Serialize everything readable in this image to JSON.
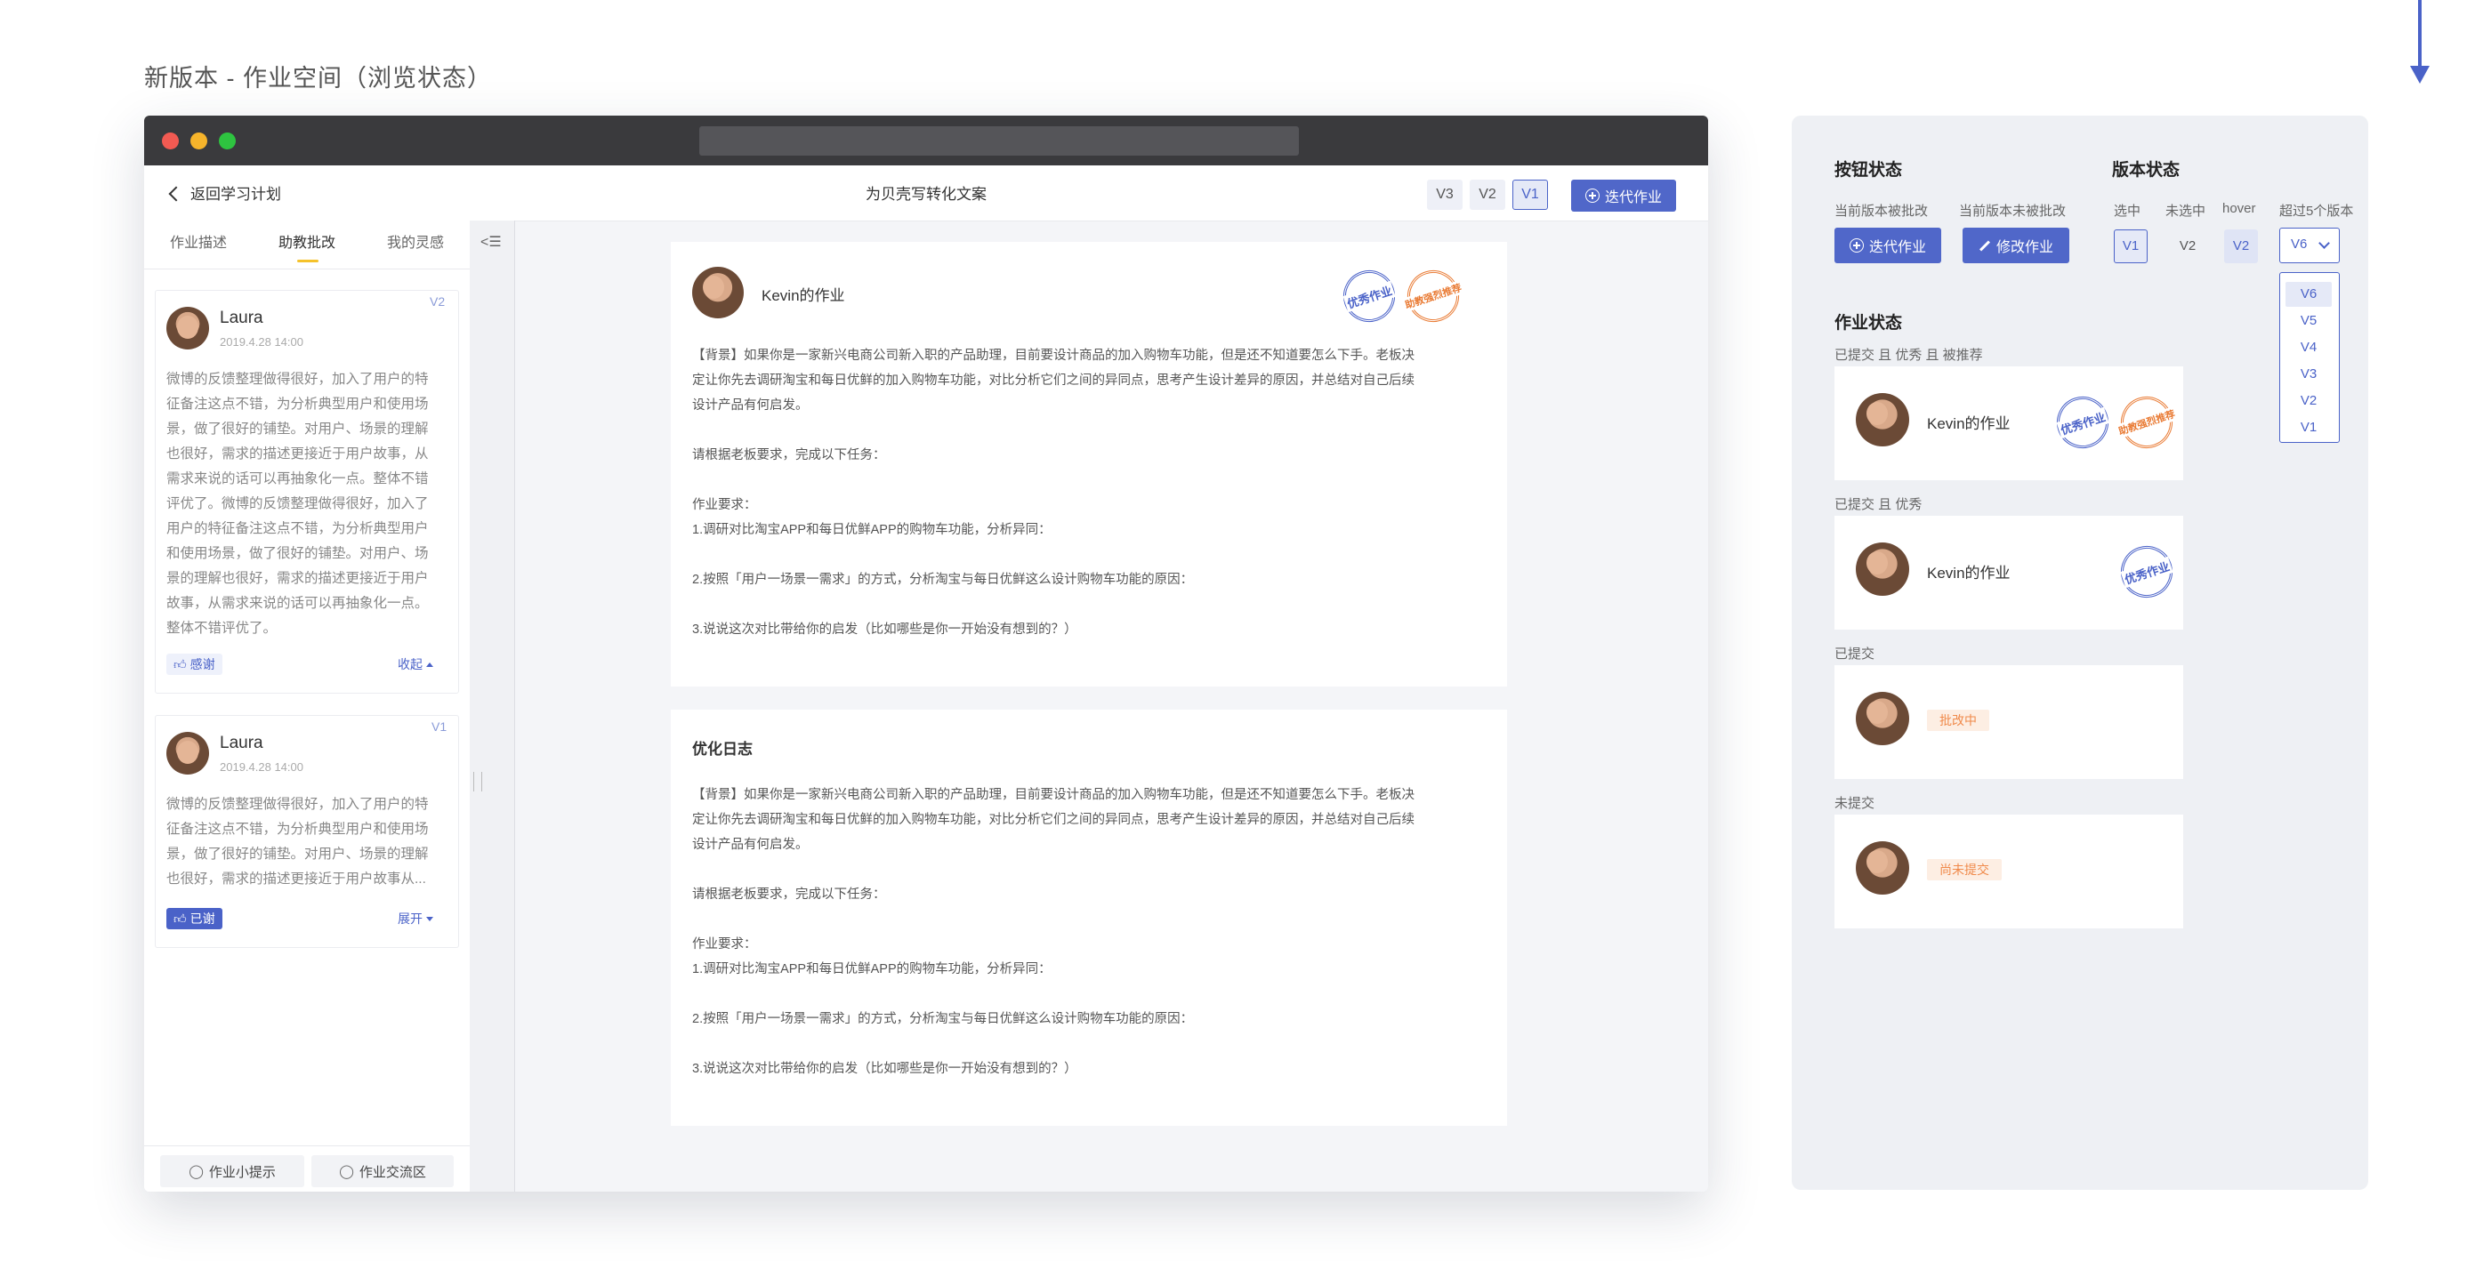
{
  "page_title": "新版本 - 作业空间（浏览状态）",
  "topbar": {
    "back_label": "返回学习计划",
    "title": "为贝壳写转化文案",
    "versions": [
      "V3",
      "V2",
      "V1"
    ],
    "active_version": "V1",
    "iterate_label": "迭代作业"
  },
  "left_tabs": [
    "作业描述",
    "助教批改",
    "我的灵感"
  ],
  "active_tab": "助教批改",
  "comments": [
    {
      "name": "Laura",
      "date": "2019.4.28  14:00",
      "version": "V2",
      "lines": [
        "微博的反馈整理做得很好，加入了用户的特",
        "征备注这点不错，为分析典型用户和使用场",
        "景，做了很好的铺垫。对用户、场景的理解",
        "也很好，需求的描述更接近于用户故事，从",
        "需求来说的话可以再抽象化一点。整体不错",
        "评优了。微博的反馈整理做得很好，加入了",
        "用户的特征备注这点不错，为分析典型用户",
        "和使用场景，做了很好的铺垫。对用户、场",
        "景的理解也很好，需求的描述更接近于用户",
        "故事，从需求来说的话可以再抽象化一点。",
        "整体不错评优了。"
      ],
      "thanks_label": "感谢",
      "toggle_label": "收起"
    },
    {
      "name": "Laura",
      "date": "2019.4.28  14:00",
      "version": "V1",
      "lines": [
        "微博的反馈整理做得很好，加入了用户的特",
        "征备注这点不错，为分析典型用户和使用场",
        "景，做了很好的铺垫。对用户、场景的理解",
        "也很好，需求的描述更接近于用户故事从..."
      ],
      "thanks_label": "已谢",
      "toggle_label": "展开"
    }
  ],
  "bottom_buttons": [
    "作业小提示",
    "作业交流区"
  ],
  "homework": {
    "author": "Kevin的作业",
    "stamps": [
      "优秀作业",
      "助教强烈推荐"
    ],
    "paragraphs": [
      "【背景】如果你是一家新兴电商公司新入职的产品助理，目前要设计商品的加入购物车功能，但是还不知道要怎么下手。老板决",
      "定让你先去调研淘宝和每日优鲜的加入购物车功能，对比分析它们之间的异同点，思考产生设计差异的原因，并总结对自己后续",
      "设计产品有何启发。",
      "",
      "请根据老板要求，完成以下任务：",
      "",
      "作业要求：",
      "1.调研对比淘宝APP和每日优鲜APP的购物车功能，分析异同：",
      "",
      "2.按照「用户一场景一需求」的方式，分析淘宝与每日优鲜这么设计购物车功能的原因：",
      "",
      "3.说说这次对比带给你的启发（比如哪些是你一开始没有想到的？）"
    ]
  },
  "log": {
    "title": "优化日志",
    "paragraphs": [
      "【背景】如果你是一家新兴电商公司新入职的产品助理，目前要设计商品的加入购物车功能，但是还不知道要怎么下手。老板决",
      "定让你先去调研淘宝和每日优鲜的加入购物车功能，对比分析它们之间的异同点，思考产生设计差异的原因，并总结对自己后续",
      "设计产品有何启发。",
      "",
      "请根据老板要求，完成以下任务：",
      "",
      "作业要求：",
      "1.调研对比淘宝APP和每日优鲜APP的购物车功能，分析异同：",
      "",
      "2.按照「用户一场景一需求」的方式，分析淘宝与每日优鲜这么设计购物车功能的原因：",
      "",
      "3.说说这次对比带给你的启发（比如哪些是你一开始没有想到的？）"
    ]
  },
  "right": {
    "button_states_title": "按钮状态",
    "version_states_title": "版本状态",
    "btn_labels": [
      "当前版本被批改",
      "当前版本未被批改"
    ],
    "btn_iterate": "迭代作业",
    "btn_edit": "修改作业",
    "ver_labels": [
      "选中",
      "未选中",
      "hover",
      "超过5个版本"
    ],
    "ver_values": [
      "V1",
      "V2",
      "V2"
    ],
    "dropdown_value": "V6",
    "dropdown_options": [
      "V6",
      "V5",
      "V4",
      "V3",
      "V2",
      "V1"
    ],
    "homework_states_title": "作业状态",
    "states": [
      {
        "label": "已提交 且 优秀 且 被推荐",
        "name": "Kevin的作业"
      },
      {
        "label": "已提交 且 优秀",
        "name": "Kevin的作业"
      },
      {
        "label": "已提交",
        "tag": "批改中"
      },
      {
        "label": "未提交",
        "tag": "尚未提交"
      }
    ]
  },
  "colors": {
    "primary": "#5067c9",
    "accent_yellow": "#f5c22b",
    "stamp_orange": "#e97a33"
  }
}
